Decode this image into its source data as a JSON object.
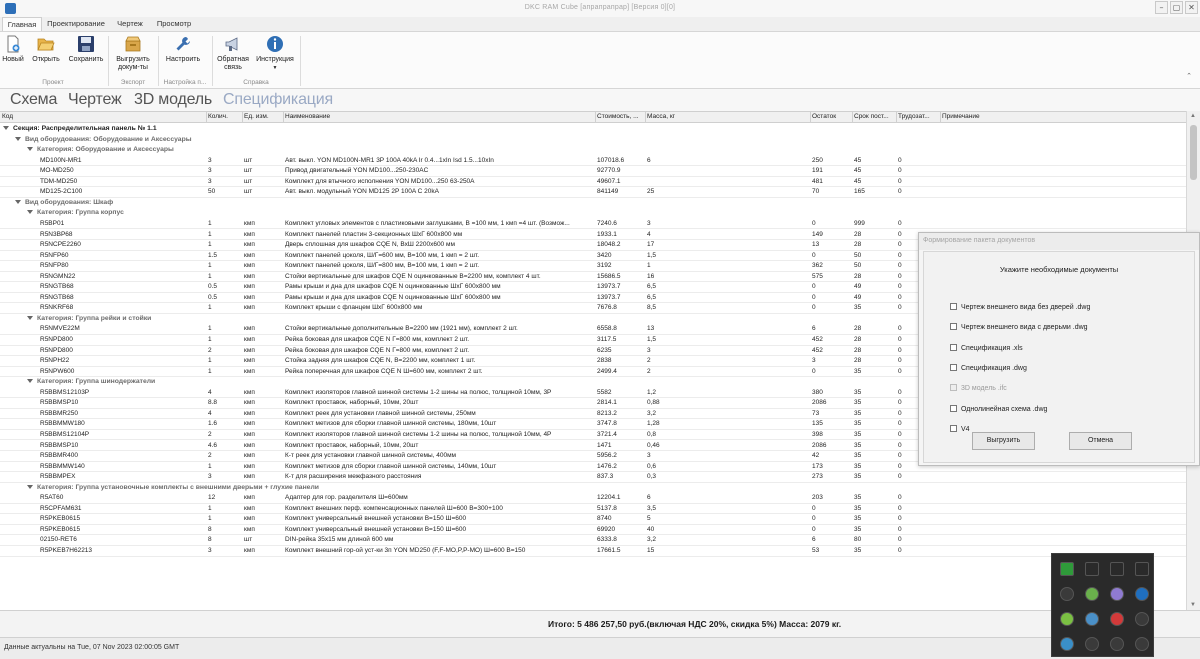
{
  "window": {
    "title": "DKC RAM Cube [апрапрапрар] [Версия 0][0]",
    "min_glyph": "–",
    "max_glyph": "▢",
    "close_glyph": "✕"
  },
  "ribbon_tabs": [
    {
      "label": "Главная",
      "active": true
    },
    {
      "label": "Проектирование",
      "active": false
    },
    {
      "label": "Чертеж",
      "active": false
    },
    {
      "label": "Просмотр",
      "active": false
    }
  ],
  "ribbon": {
    "buttons": {
      "new": "Новый",
      "open": "Открыть",
      "save": "Сохранить",
      "export_1": "Выгрузить",
      "export_2": "докум-ты",
      "settings": "Настроить",
      "feedback_1": "Обратная",
      "feedback_2": "связь",
      "instruction": "Инструкция"
    },
    "groups": {
      "project": "Проект",
      "export": "Экспорт",
      "settings": "Настройка п...",
      "help": "Справка"
    },
    "colors": {
      "save_icon": "#2b3f6b",
      "help_icon": "#2f6fb5",
      "folder_icon": "#e8b44a"
    }
  },
  "view_tabs": [
    {
      "label": "Схема",
      "active": false
    },
    {
      "label": "Чертеж",
      "active": false
    },
    {
      "label": "3D модель",
      "active": false
    },
    {
      "label": "Спецификация",
      "active": true
    }
  ],
  "columns": {
    "code": "Код",
    "qty": "Колич.",
    "unit": "Ед. изм.",
    "name": "Наименование",
    "cost": "Стоимость, ...",
    "mass": "Масса, кг",
    "stock": "Остаток",
    "lead": "Срок пост...",
    "labor": "Трудозат...",
    "note": "Примечание"
  },
  "grid": {
    "section": "Секция: Распределительная панель № 1.1",
    "groups": [
      {
        "type": "Вид оборудования: Оборудование и Аксессуары",
        "categories": [
          {
            "title": "Категория: Оборудование и Аксессуары",
            "rows": [
              [
                "MD100N-MR1",
                "3",
                "шт",
                "Авт. выкл. YON MD100N-MR1 3P 100A 40kA Ir 0.4...1xIn Isd 1.5...10xIn",
                "107018.6",
                "6",
                "250",
                "45",
                "0"
              ],
              [
                "MO-MD250",
                "3",
                "шт",
                "Привод двигательный YON MD100...250-230AC",
                "92770.9",
                "",
                "191",
                "45",
                "0"
              ],
              [
                "TDM-MD250",
                "3",
                "шт",
                "Комплект для втычного исполнения YON MD100...250 63-250A",
                "49607.1",
                "",
                "481",
                "45",
                "0"
              ],
              [
                "MD125-2C100",
                "50",
                "шт",
                "Авт. выкл. модульный YON MD125 2P 100A C 20kA",
                "841149",
                "25",
                "70",
                "165",
                "0"
              ]
            ]
          }
        ]
      },
      {
        "type": "Вид оборудования: Шкаф",
        "categories": [
          {
            "title": "Категория: Группа корпус",
            "rows": [
              [
                "R5BP01",
                "1",
                "кмп",
                "Комплект угловых элементов с пластиковыми заглушками, В =100 мм, 1 кмп =4 шт. (Возмож...",
                "7240.6",
                "3",
                "0",
                "999",
                "0"
              ],
              [
                "R5N3BP68",
                "1",
                "кмп",
                "Комплект панелей пластин 3-секционных ШхГ 600х800 мм",
                "1933.1",
                "4",
                "149",
                "28",
                "0"
              ],
              [
                "R5NCPE2260",
                "1",
                "кмп",
                "Дверь сплошная для шкафов CQE N, ВхШ 2200х600 мм",
                "18048.2",
                "17",
                "13",
                "28",
                "0"
              ],
              [
                "R5NFP60",
                "1.5",
                "кмп",
                "Комплект панелей цоколя, Ш/Г=600 мм, В=100 мм, 1 кмп = 2 шт.",
                "3420",
                "1,5",
                "0",
                "50",
                "0"
              ],
              [
                "R5NFP80",
                "1",
                "кмп",
                "Комплект панелей цоколя, Ш/Г=800 мм, В=100 мм, 1 кмп = 2 шт.",
                "3192",
                "1",
                "362",
                "50",
                "0"
              ],
              [
                "R5NGMN22",
                "1",
                "кмп",
                "Стойки вертикальные для шкафов CQE N оцинкованные В=2200 мм, комплект 4 шт.",
                "15686.5",
                "16",
                "575",
                "28",
                "0"
              ],
              [
                "R5NGTB68",
                "0.5",
                "кмп",
                "Рамы крыши и дна для шкафов CQE N оцинкованные ШхГ 600х800 мм",
                "13973.7",
                "6,5",
                "0",
                "49",
                "0"
              ],
              [
                "R5NGTB68",
                "0.5",
                "кмп",
                "Рамы крыши и дна для шкафов CQE N оцинкованные ШхГ 600х800 мм",
                "13973.7",
                "6,5",
                "0",
                "49",
                "0"
              ],
              [
                "R5NKRF68",
                "1",
                "кмп",
                "Комплект крыши с фланцем ШхГ 600х800 мм",
                "7676.8",
                "8,5",
                "0",
                "35",
                "0"
              ]
            ]
          },
          {
            "title": "Категория: Группа рейки и стойки",
            "rows": [
              [
                "R5NMVE22M",
                "1",
                "кмп",
                "Стойки вертикальные дополнительные В=2200 мм (1921 мм), комплект 2 шт.",
                "6558.8",
                "13",
                "6",
                "28",
                "0"
              ],
              [
                "R5NPD800",
                "1",
                "кмп",
                "Рейка боковая для шкафов CQE N Г=800 мм, комплект 2 шт.",
                "3117.5",
                "1,5",
                "452",
                "28",
                "0"
              ],
              [
                "R5NPD800",
                "2",
                "кмп",
                "Рейка боковая для шкафов CQE N Г=800 мм, комплект 2 шт.",
                "6235",
                "3",
                "452",
                "28",
                "0"
              ],
              [
                "R5NPH22",
                "1",
                "кмп",
                "Стойка задняя для шкафов CQE N, В=2200 мм, комплект 1 шт.",
                "2838",
                "2",
                "3",
                "28",
                "0"
              ],
              [
                "R5NPW600",
                "1",
                "кмп",
                "Рейка поперечная для шкафов CQE N Ш=600 мм, комплект 2 шт.",
                "2499.4",
                "2",
                "0",
                "35",
                "0"
              ]
            ]
          },
          {
            "title": "Категория: Группа шинодержатели",
            "rows": [
              [
                "R5BBMS12103P",
                "4",
                "кмп",
                "Комплект изоляторов главной шинной системы 1-2 шины на полюс, толщиной 10мм, 3P",
                "5582",
                "1,2",
                "380",
                "35",
                "0"
              ],
              [
                "R5BBMSP10",
                "8.8",
                "кмп",
                "Комплект проставок, наборный, 10мм, 20шт",
                "2814.1",
                "0,88",
                "2086",
                "35",
                "0"
              ],
              [
                "R5BBMR250",
                "4",
                "кмп",
                "Комплект реек для установки главной шинной системы, 250мм",
                "8213.2",
                "3,2",
                "73",
                "35",
                "0"
              ],
              [
                "R5BBMMW180",
                "1.6",
                "кмп",
                "Комплект метизов для сборки главной шинной системы, 180мм, 10шт",
                "3747.8",
                "1,28",
                "135",
                "35",
                "0"
              ],
              [
                "R5BBMS12104P",
                "2",
                "кмп",
                "Комплект изоляторов главной шинной системы 1-2 шины на полюс, толщиной 10мм, 4P",
                "3721.4",
                "0,8",
                "398",
                "35",
                "0"
              ],
              [
                "R5BBMSP10",
                "4.6",
                "кмп",
                "Комплект проставок, наборный, 10мм, 20шт",
                "1471",
                "0,46",
                "2086",
                "35",
                "0"
              ],
              [
                "R5BBMR400",
                "2",
                "кмп",
                "К-т реек для установки главной шинной системы, 400мм",
                "5956.2",
                "3",
                "42",
                "35",
                "0"
              ],
              [
                "R5BBMMW140",
                "1",
                "кмп",
                "Комплект метизов для сборки главной шинной системы, 140мм, 10шт",
                "1476.2",
                "0,6",
                "173",
                "35",
                "0"
              ],
              [
                "R5BBMPEX",
                "3",
                "кмп",
                "К-т для расширения межфазного расстояния",
                "837.3",
                "0,3",
                "273",
                "35",
                "0"
              ]
            ]
          },
          {
            "title": "Категория: Группа установочные комплекты с внешними дверьми + глухие панели",
            "rows": [
              [
                "R5AT60",
                "12",
                "кмп",
                "Адаптер для гор. разделителя Ш=600мм",
                "12204.1",
                "6",
                "203",
                "35",
                "0"
              ],
              [
                "R5CPFAM631",
                "1",
                "кмп",
                "Комплект внешних перф. компенсационных панелей Ш=600 В=300+100",
                "5137.8",
                "3,5",
                "0",
                "35",
                "0"
              ],
              [
                "R5PKEB0615",
                "1",
                "кмп",
                "Комплект универсальный внешней установки В=150 Ш=600",
                "8740",
                "5",
                "0",
                "35",
                "0"
              ],
              [
                "R5PKEB0615",
                "8",
                "кмп",
                "Комплект универсальный внешней установки В=150 Ш=600",
                "69920",
                "40",
                "0",
                "35",
                "0"
              ],
              [
                "02150-RET6",
                "8",
                "шт",
                "DIN-рейка 35х15 мм длиной 600 мм",
                "6333.8",
                "3,2",
                "6",
                "80",
                "0"
              ],
              [
                "R5PKEB7H62213",
                "3",
                "кмп",
                "Комплект внешний гор-ой уст-ки 3п YON MD250 (F,F-MO,P,P-MO) Ш=600 В=150",
                "17661.5",
                "15",
                "53",
                "35",
                "0"
              ]
            ]
          }
        ]
      }
    ]
  },
  "total": {
    "text": "Итого: 5 486 257,50 руб.(включая НДС 20%, скидка 5%) Масса: 2079 кг."
  },
  "status": {
    "text": "Данные актуальны на Tue, 07 Nov 2023 02:00:05 GMT"
  },
  "dialog": {
    "title": "Формирование пакета документов",
    "prompt": "Укажите необходимые документы",
    "options": [
      {
        "label": "Чертеж внешнего вида без дверей .dwg",
        "disabled": false
      },
      {
        "label": "Чертеж внешнего вида с дверьми .dwg",
        "disabled": false
      },
      {
        "label": "Спецификация .xls",
        "disabled": false
      },
      {
        "label": "Спецификация .dwg",
        "disabled": false
      },
      {
        "label": "3D модель .ifc",
        "disabled": true
      },
      {
        "label": "Однолинейная схема .dwg",
        "disabled": false
      },
      {
        "label": "V4",
        "disabled": false
      }
    ],
    "export_button": "Выгрузить",
    "cancel_button": "Отмена"
  },
  "tray": {
    "icons": [
      {
        "name": "nvidia-icon",
        "color": "#2f9a3a"
      },
      {
        "name": "blank-square-icon-1",
        "color": "#2a2a2a"
      },
      {
        "name": "blank-square-icon-2",
        "color": "#2a2a2a"
      },
      {
        "name": "copy-icon",
        "color": "#2a2a2a"
      },
      {
        "name": "speedometer-icon",
        "color": "#3a3a3a"
      },
      {
        "name": "check-shield-icon",
        "color": "#6ab04c"
      },
      {
        "name": "feather-icon",
        "color": "#8f7bd1"
      },
      {
        "name": "outlook-icon",
        "color": "#1f6fc0"
      },
      {
        "name": "green-circle-icon",
        "color": "#7bc043"
      },
      {
        "name": "globe-icon",
        "color": "#4a90c8"
      },
      {
        "name": "red-app-icon",
        "color": "#d23a3a"
      },
      {
        "name": "bluetooth-icon",
        "color": "#3a3a3a"
      },
      {
        "name": "teams-icon",
        "color": "#3a8fc8"
      },
      {
        "name": "wifi-icon",
        "color": "#3a3a3a"
      },
      {
        "name": "gpu-icon",
        "color": "#3a3a3a"
      },
      {
        "name": "speaker-icon",
        "color": "#3a3a3a"
      }
    ]
  }
}
